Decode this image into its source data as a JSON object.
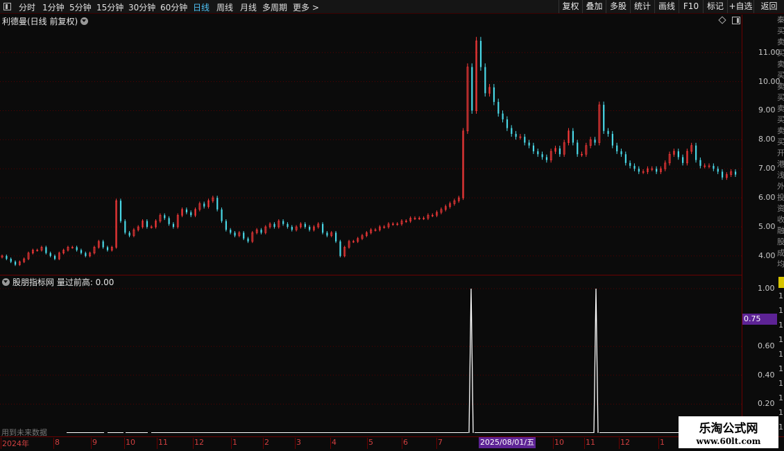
{
  "toolbar": {
    "periods": [
      {
        "label": "分时",
        "active": false
      },
      {
        "label": "1分钟",
        "active": false
      },
      {
        "label": "5分钟",
        "active": false
      },
      {
        "label": "15分钟",
        "active": false
      },
      {
        "label": "30分钟",
        "active": false
      },
      {
        "label": "60分钟",
        "active": false
      },
      {
        "label": "日线",
        "active": true
      },
      {
        "label": "周线",
        "active": false
      },
      {
        "label": "月线",
        "active": false
      },
      {
        "label": "多周期",
        "active": false
      },
      {
        "label": "更多 >",
        "active": false
      }
    ],
    "buttons": [
      "复权",
      "叠加",
      "多股",
      "统计",
      "画线",
      "F10",
      "标记",
      "+自选",
      "返回"
    ]
  },
  "main_chart": {
    "title": "利德曼(日线 前复权)",
    "price_ticks": [
      "11.00",
      "10.00",
      "9.00",
      "8.00",
      "7.00",
      "6.00",
      "5.00",
      "4.00"
    ],
    "side_glyphs": [
      "秦",
      "买",
      "卖",
      "买",
      "卖",
      "买",
      "卖",
      "买",
      "卖",
      "买",
      "卖",
      "买",
      "开",
      "港",
      "浅",
      "外",
      "投",
      "资",
      "收",
      "融",
      "股",
      "成",
      "均"
    ]
  },
  "sub_chart": {
    "title": "股朋指标网 量过前高: 0.00",
    "ticks": [
      "1.00",
      "0.60",
      "0.40",
      "0.20"
    ],
    "side_ticks": [
      "1",
      "1",
      "1",
      "1",
      "1",
      "1",
      "1",
      "1",
      "1",
      "1",
      "1"
    ],
    "cursor_value": "0.75",
    "future_note": "用到未来数据"
  },
  "date_axis": {
    "labels": [
      "2024年",
      "8",
      "9",
      "10",
      "11",
      "12",
      "1",
      "2",
      "3",
      "4",
      "5",
      "6",
      "7",
      "10",
      "11",
      "12",
      "1"
    ],
    "cursor_date": "2025/08/01/五"
  },
  "watermark": {
    "title": "乐淘公式网",
    "url": "www.60lt.com"
  },
  "colors": {
    "up": "#ff3b3b",
    "down": "#4ad9e8",
    "signal": "#ffffff",
    "grid": "#5a0000",
    "accent": "#5d2395"
  },
  "chart_data": [
    {
      "type": "candlestick",
      "title": "利德曼(日线 前复权)",
      "xlabel": "",
      "ylabel": "",
      "ylim": [
        3.4,
        11.9
      ],
      "series": [
        {
          "close_values_by_month": [
            {
              "period": "2024年7",
              "close": [
                4.0,
                3.9,
                3.8,
                3.7,
                3.8,
                3.9,
                4.1,
                4.2
              ]
            },
            {
              "period": "2024-08",
              "close": [
                4.2,
                4.3,
                4.1,
                4.0,
                3.9,
                4.1,
                4.2,
                4.3
              ]
            },
            {
              "period": "2024-09",
              "close": [
                4.3,
                4.2,
                4.1,
                4.0,
                4.1,
                4.3,
                4.5,
                4.3,
                4.2,
                4.3
              ]
            },
            {
              "period": "2024-10",
              "close": [
                5.9,
                5.2,
                4.8,
                4.7,
                4.9,
                5.0,
                5.2,
                5.0
              ]
            },
            {
              "period": "2024-11",
              "close": [
                5.0,
                5.2,
                5.4,
                5.3,
                5.1,
                5.0,
                5.4,
                5.6,
                5.5,
                5.4
              ]
            },
            {
              "period": "2024-12",
              "close": [
                5.6,
                5.8,
                5.7,
                5.9,
                6.0,
                5.6,
                5.2,
                4.9,
                4.8
              ]
            },
            {
              "period": "2025-01",
              "close": [
                4.7,
                4.8,
                4.6,
                4.5,
                4.8,
                4.9
              ]
            },
            {
              "period": "2025-02",
              "close": [
                4.8,
                5.0,
                5.1,
                5.0,
                5.2,
                5.1
              ]
            },
            {
              "period": "2025-03",
              "close": [
                5.0,
                4.9,
                5.0,
                5.1,
                5.0,
                4.9,
                5.0,
                5.1,
                4.8
              ]
            },
            {
              "period": "2025-04",
              "close": [
                4.7,
                4.8,
                4.5,
                4.0,
                4.3,
                4.5,
                4.5,
                4.6
              ]
            },
            {
              "period": "2025-05",
              "close": [
                4.7,
                4.8,
                4.9,
                4.9,
                5.0,
                5.0,
                5.1
              ]
            },
            {
              "period": "2025-06",
              "close": [
                5.1,
                5.1,
                5.2,
                5.2,
                5.3,
                5.3,
                5.3,
                5.3
              ]
            },
            {
              "period": "2025-07",
              "close": [
                5.4,
                5.4,
                5.5,
                5.6,
                5.7,
                5.8,
                5.9,
                6.0
              ]
            },
            {
              "period": "2025-08",
              "close": [
                8.3,
                10.5,
                9.0,
                11.4,
                10.5,
                9.6,
                9.8,
                9.3,
                8.9,
                8.7,
                8.4
              ]
            },
            {
              "period": "2025-09",
              "close": [
                8.2,
                8.1,
                8.1,
                7.9,
                7.8,
                7.6,
                7.5,
                7.4,
                7.3,
                7.6,
                7.7,
                7.5
              ]
            },
            {
              "period": "2025-10",
              "close": [
                7.9,
                8.3,
                7.9,
                7.5,
                7.5,
                7.8,
                8.0,
                7.9
              ]
            },
            {
              "period": "2025-11",
              "close": [
                9.2,
                8.3,
                8.2,
                7.8,
                7.6,
                7.5,
                7.2,
                7.1,
                7.0,
                6.9,
                6.9,
                7.0
              ]
            },
            {
              "period": "2025-12",
              "close": [
                7.0,
                6.9,
                7.0,
                7.2,
                7.5,
                7.6,
                7.4,
                7.2,
                7.6,
                7.8,
                7.3,
                7.1,
                7.1,
                7.1,
                7.0
              ]
            },
            {
              "period": "2026-01",
              "close": [
                6.9,
                6.7,
                6.8,
                6.9,
                6.8
              ]
            }
          ]
        }
      ]
    },
    {
      "type": "line",
      "title": "股朋指标网 量过前高",
      "xlabel": "",
      "ylabel": "",
      "ylim": [
        0,
        1.0
      ],
      "series": [
        {
          "name": "量过前高",
          "points": [
            {
              "x": "2025-07-28",
              "y": 1.0
            },
            {
              "x": "2025-11-03",
              "y": 1.0
            }
          ],
          "baseline": 0.0
        }
      ]
    }
  ]
}
